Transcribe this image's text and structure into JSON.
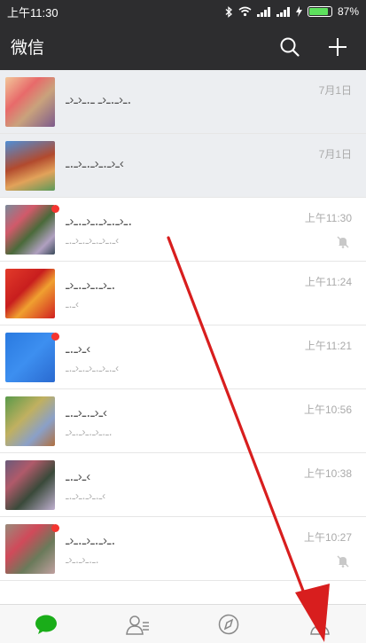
{
  "status_bar": {
    "time": "上午11:30",
    "battery_percent": "87%",
    "battery_level": 0.87
  },
  "header": {
    "title": "微信"
  },
  "chats": [
    {
      "name": "ـ‹ـ․ـ‹ـ  ـ․ـ‹ـ‹ـ․",
      "preview": "",
      "time": "7月1日",
      "pinned": true,
      "muted": false,
      "unread": false
    },
    {
      "name": "ـ‹ـ․ـ‹ـ․ـ‹ـ․ـ‹",
      "preview": "",
      "time": "7月1日",
      "pinned": true,
      "muted": false,
      "unread": false
    },
    {
      "name": "ـ‹ـ․ـ‹ـ․ـ‹ـ․ـ‹ـ․",
      "preview": "ـ․ـ‹ـ․ـ‹ـ․ـ‹ـ․ـ‹",
      "time": "上午11:30",
      "pinned": false,
      "muted": true,
      "unread": true
    },
    {
      "name": "ـ‹ـ․ـ‹ـ․ـ‹ـ․",
      "preview": "ـ․ـ‹",
      "time": "上午11:24",
      "pinned": false,
      "muted": false,
      "unread": false
    },
    {
      "name": "ـ‹ـ․ـ‹",
      "preview": "ـ․ـ‹ـ․ـ‹ـ․ـ‹ـ․ـ‹",
      "time": "上午11:21",
      "pinned": false,
      "muted": false,
      "unread": true
    },
    {
      "name": "ـ‹ـ․ـ‹ـ․ـ‹",
      "preview": "ـ․ـ‹ـ․ـ‹ـ․ـ‹ـ․",
      "time": "上午10:56",
      "pinned": false,
      "muted": false,
      "unread": false
    },
    {
      "name": "ـ‹ـ․ـ‹",
      "preview": "ـ․ـ‹ـ․ـ‹ـ․ـ‹",
      "time": "上午10:38",
      "pinned": false,
      "muted": false,
      "unread": false
    },
    {
      "name": "ـ‹ـ․ـ‹ـ․ـ‹ـ․",
      "preview": "ـ․ـ‹ـ․ـ‹ـ․",
      "time": "上午10:27",
      "pinned": false,
      "muted": true,
      "unread": true
    }
  ],
  "tabs": [
    {
      "id": "chats",
      "icon": "chat-bubble-icon",
      "active": true
    },
    {
      "id": "contacts",
      "icon": "contacts-icon",
      "active": false
    },
    {
      "id": "discover",
      "icon": "compass-icon",
      "active": false
    },
    {
      "id": "me",
      "icon": "person-icon",
      "active": false
    }
  ],
  "colors": {
    "header_bg": "#2d2d2f",
    "accent": "#1aad19",
    "badge": "#f43530",
    "arrow": "#d81e1e"
  }
}
